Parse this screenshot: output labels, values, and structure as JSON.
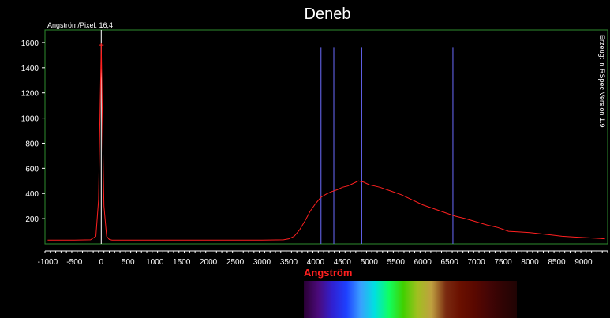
{
  "chart_data": {
    "type": "line",
    "title": "Deneb",
    "xlabel": "Angström",
    "ylabel": "",
    "dispersion_label": "Angström/Pixel: 16,4",
    "credit": "Erzeugt in RSpec Version 1.9",
    "xlim": [
      -1050,
      9450
    ],
    "ylim": [
      0,
      1700
    ],
    "x_ticks": [
      -1000,
      -500,
      0,
      500,
      1000,
      1500,
      2000,
      2500,
      3000,
      3500,
      4000,
      4500,
      5000,
      5500,
      6000,
      6500,
      7000,
      7500,
      8000,
      8500,
      9000
    ],
    "y_ticks": [
      200,
      400,
      600,
      800,
      1000,
      1200,
      1400,
      1600
    ],
    "grid": false,
    "series": [
      {
        "color": "#ff2020",
        "x": [
          -1000,
          -500,
          -200,
          -100,
          -50,
          -20,
          0,
          20,
          50,
          100,
          150,
          200,
          500,
          1000,
          2000,
          3000,
          3400,
          3500,
          3600,
          3700,
          3800,
          3900,
          4000,
          4100,
          4200,
          4300,
          4400,
          4500,
          4600,
          4700,
          4800,
          4900,
          5000,
          5100,
          5200,
          5400,
          5600,
          5800,
          6000,
          6200,
          6400,
          6600,
          6800,
          7000,
          7200,
          7400,
          7600,
          7800,
          8000,
          8200,
          8400,
          8600,
          8800,
          9000,
          9200,
          9400
        ],
        "y": [
          30,
          30,
          32,
          60,
          350,
          1100,
          1580,
          1000,
          300,
          60,
          35,
          30,
          30,
          30,
          30,
          30,
          32,
          40,
          60,
          110,
          180,
          260,
          320,
          370,
          395,
          415,
          430,
          450,
          460,
          480,
          500,
          490,
          470,
          460,
          450,
          420,
          390,
          350,
          310,
          280,
          250,
          220,
          200,
          175,
          150,
          130,
          100,
          95,
          90,
          80,
          70,
          60,
          55,
          50,
          45,
          40
        ]
      }
    ],
    "marker_lines": [
      4101,
      4340,
      4861,
      6563
    ],
    "marker_color": "#6b6bff",
    "reference_line": 0,
    "spectrum_colors": [
      "#2a0033",
      "#4b0a7a",
      "#3020d0",
      "#1e40ff",
      "#3aa0ff",
      "#00e0e0",
      "#10ff60",
      "#40d000",
      "#a0c020",
      "#c0a040",
      "#7a2a10",
      "#6a1000",
      "#5a0800",
      "#440505",
      "#300404",
      "#200404"
    ]
  }
}
